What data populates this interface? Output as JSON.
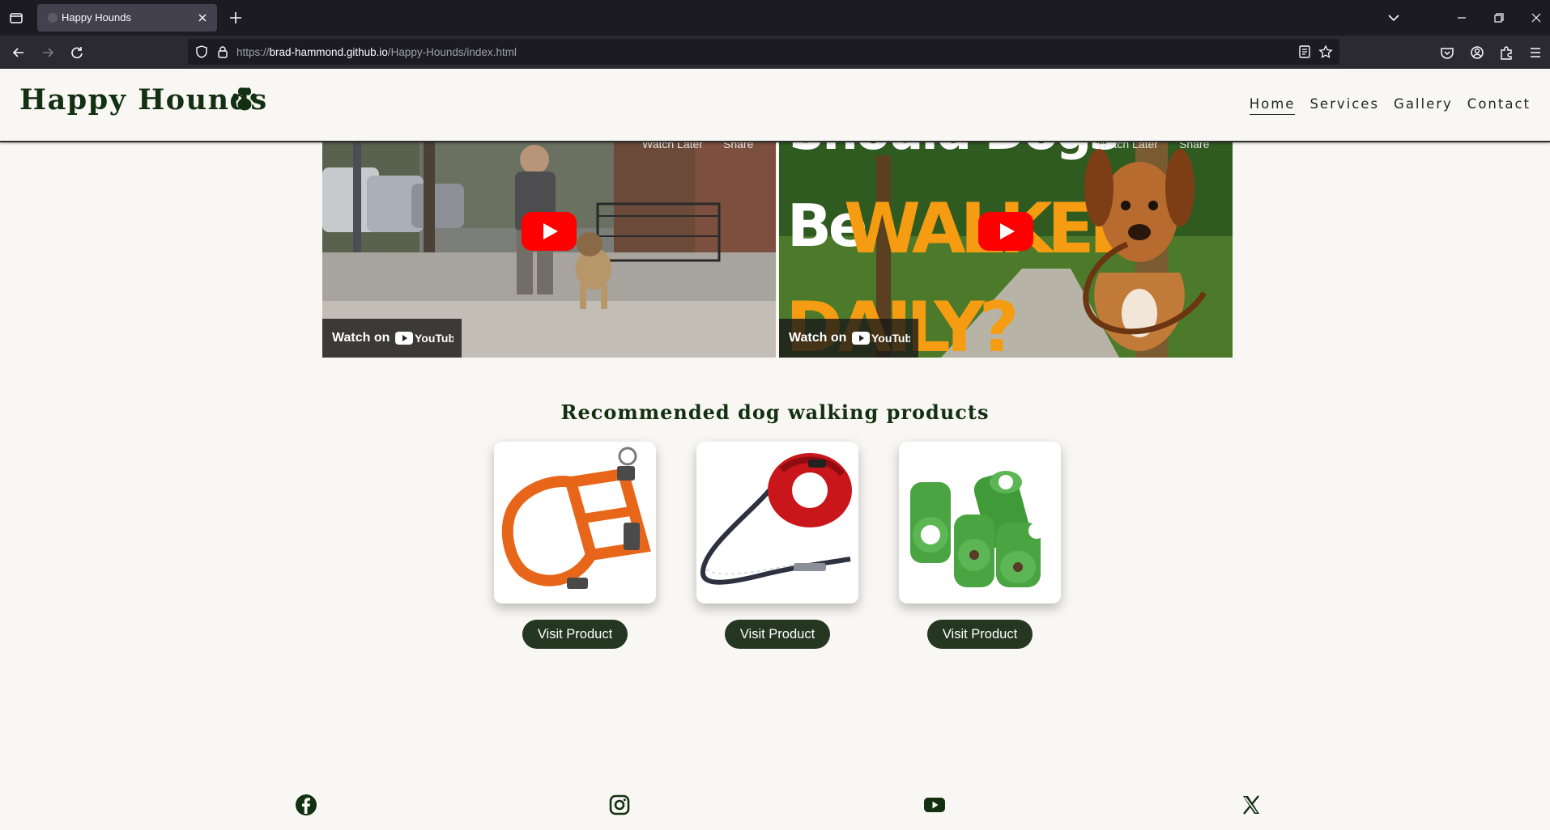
{
  "browser": {
    "tab_title": "Happy Hounds",
    "url_prefix": "https://",
    "url_host": "brad-hammond.github.io",
    "url_path": "/Happy-Hounds/index.html"
  },
  "header": {
    "logo_text": "Happy Hounds",
    "nav": [
      {
        "label": "Home",
        "active": true
      },
      {
        "label": "Services",
        "active": false
      },
      {
        "label": "Gallery",
        "active": false
      },
      {
        "label": "Contact",
        "active": false
      }
    ]
  },
  "videos": [
    {
      "watch_label": "Watch on",
      "provider": "YouTube",
      "watch_later": "Watch Later",
      "share": "Share"
    },
    {
      "watch_label": "Watch on",
      "provider": "YouTube",
      "watch_later": "Watch Later",
      "share": "Share",
      "thumbnail_text": [
        "Should Dogs",
        "Be",
        "WALKED",
        "DAILY?"
      ]
    }
  ],
  "products": {
    "title": "Recommended dog walking products",
    "items": [
      {
        "icon": "dog-harness-image",
        "button": "Visit Product"
      },
      {
        "icon": "retractable-leash-image",
        "button": "Visit Product"
      },
      {
        "icon": "poop-bag-rolls-image",
        "button": "Visit Product"
      }
    ]
  },
  "footer": {
    "socials": [
      "facebook-icon",
      "instagram-icon",
      "youtube-icon",
      "x-icon"
    ]
  },
  "colors": {
    "brand_dark_green": "#133012",
    "button_bg": "#253621",
    "page_bg": "#f8f7f3",
    "youtube_red": "#ff0000"
  }
}
